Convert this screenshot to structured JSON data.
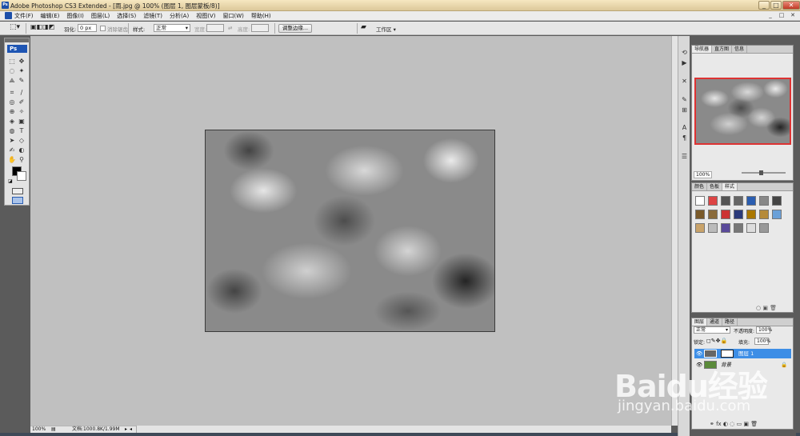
{
  "window": {
    "title": "Adobe Photoshop CS3 Extended - [雨.jpg @ 100% (图层 1, 图层蒙板/8)]",
    "controls": [
      "_",
      "□",
      "✕"
    ]
  },
  "menu": {
    "items": [
      "文件(F)",
      "编辑(E)",
      "图像(I)",
      "图层(L)",
      "选择(S)",
      "滤镜(T)",
      "分析(A)",
      "视图(V)",
      "窗口(W)",
      "帮助(H)"
    ],
    "doc_controls": [
      "_",
      "□",
      "✕"
    ]
  },
  "options": {
    "feather_label": "羽化:",
    "feather_value": "0 px",
    "antialias_label": "消除锯齿",
    "style_label": "样式:",
    "style_value": "正常",
    "width_label": "宽度:",
    "height_label": "高度:",
    "refine_edge": "调整边缘...",
    "workspace": "工作区 ▾"
  },
  "toolbox": {
    "logo": "Ps",
    "tools": [
      "⬚",
      "✥",
      "◌",
      "✦",
      "⟁",
      "✎",
      "⌗",
      "∕",
      "◎",
      "✐",
      "⊕",
      "✧",
      "◈",
      "▣",
      "◍",
      "◐",
      "✍",
      "T",
      "➤",
      "◇",
      "✋",
      "⚲"
    ]
  },
  "status": {
    "zoom": "100%",
    "doc_info": "文档:1000.8K/1.99M"
  },
  "navigator": {
    "tabs": [
      "导航器",
      "直方图",
      "信息"
    ],
    "zoom": "100%"
  },
  "styles_panel": {
    "tabs": [
      "颜色",
      "色板",
      "样式"
    ],
    "swatch_colors": [
      "#ffffff",
      "#d44",
      "#555",
      "#666",
      "#2a5db0",
      "#888",
      "#444",
      "#7a5a2a",
      "#8a6a3a",
      "#c33",
      "#2a3a7a",
      "#a70",
      "#b58a3a",
      "#6aa0d8",
      "#c9a36a",
      "#bbb",
      "#5a4a9a",
      "#777",
      "#ddd",
      "#999"
    ]
  },
  "layers_panel": {
    "tabs": [
      "图层",
      "通道",
      "路径"
    ],
    "blend_mode": "正常",
    "opacity_label": "不透明度:",
    "opacity_value": "100%",
    "lock_label": "锁定:",
    "fill_label": "填充:",
    "fill_value": "100%",
    "layers": [
      {
        "name": "图层 1",
        "selected": true
      },
      {
        "name": "背景",
        "selected": false
      }
    ]
  },
  "watermark": {
    "brand": "Baidu经验",
    "url": "jingyan.baidu.com"
  }
}
